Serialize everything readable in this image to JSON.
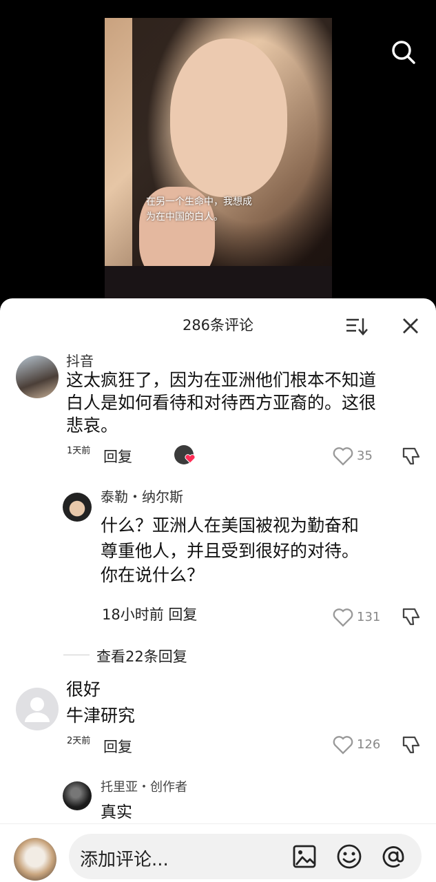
{
  "video": {
    "caption_line1": "在另一个生命中，我想成",
    "caption_line2": "为在中国的白人。"
  },
  "comments_header": {
    "title": "286条评论"
  },
  "comments": [
    {
      "username": "抖音",
      "text_line1": "这太疯狂了，因为在亚洲他们根本不知道",
      "text_line2": "白人是如何看待和对待西方亚裔的。这很",
      "text_line3": "悲哀。",
      "time": "1天前",
      "reply_label": "回复",
      "likes": "35"
    },
    {
      "username": "泰勒・纳尔斯",
      "text_line1": "什么？亚洲人在美国被视为勤奋和",
      "text_line2": "尊重他人，并且受到很好的对待。",
      "text_line3": "你在说什么？",
      "time_reply": "18小时前 回复",
      "likes": "131"
    },
    {
      "view_replies": "查看22条回复"
    },
    {
      "username": "很好",
      "text_line1": "牛津研究",
      "time": "2天前",
      "reply_label": "回复",
      "likes": "126"
    },
    {
      "username": "托里亚・创作者",
      "text_line1": "真实"
    }
  ],
  "composer": {
    "placeholder": "添加评论..."
  },
  "colors": {
    "accent": "#fe2c55",
    "sheet_bg": "#ffffff",
    "page_bg": "#000000"
  }
}
